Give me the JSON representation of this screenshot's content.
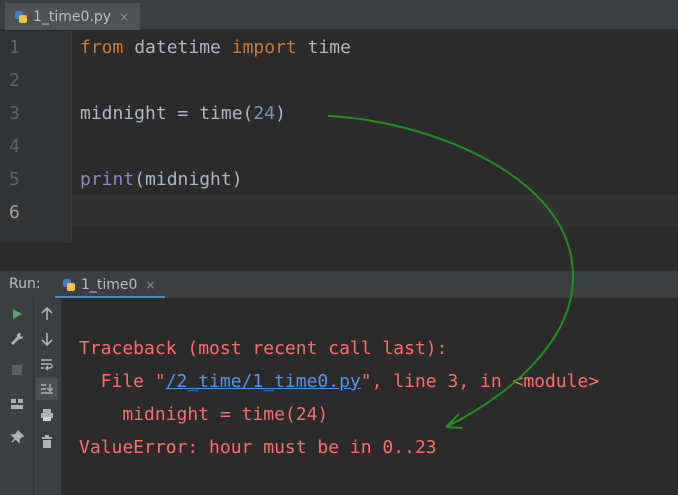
{
  "editor": {
    "tab": {
      "filename": "1_time0.py",
      "close": "×",
      "icon": "python-file-icon"
    },
    "lines": [
      {
        "no": "1",
        "tokens": [
          {
            "t": "from",
            "c": "kw"
          },
          {
            "t": " datetime ",
            "c": ""
          },
          {
            "t": "import",
            "c": "kw"
          },
          {
            "t": " time",
            "c": ""
          }
        ]
      },
      {
        "no": "2",
        "tokens": []
      },
      {
        "no": "3",
        "tokens": [
          {
            "t": "midnight = time(",
            "c": ""
          },
          {
            "t": "24",
            "c": "num"
          },
          {
            "t": ")",
            "c": ""
          }
        ]
      },
      {
        "no": "4",
        "tokens": []
      },
      {
        "no": "5",
        "tokens": [
          {
            "t": "print",
            "c": "builtin"
          },
          {
            "t": "(midnight)",
            "c": ""
          }
        ]
      },
      {
        "no": "6",
        "tokens": []
      }
    ]
  },
  "run": {
    "label": "Run:",
    "tab": {
      "name": "1_time0",
      "close": "×",
      "icon": "python-file-icon"
    },
    "toolbar_left": [
      "run-icon",
      "wrench-icon",
      "stop-icon",
      "layout-icon",
      "pin-icon"
    ],
    "toolbar_right": [
      "arrow-up-icon",
      "arrow-down-icon",
      "soft-wrap-icon",
      "scroll-to-end-icon",
      "print-icon",
      "trash-icon"
    ],
    "console": {
      "line1": "Traceback (most recent call last):",
      "line2_prefix": "  File \"",
      "line2_link": "/2_time/1_time0.py",
      "line2_suffix": "\", line 3, in <module>",
      "line3": "    midnight = time(24)",
      "line4": "ValueError: hour must be in 0..23"
    }
  },
  "colors": {
    "keyword": "#cc7832",
    "number": "#6897bb",
    "builtin": "#8888c6",
    "error": "#ff6b68",
    "link": "#5394ec",
    "annotation_arrow": "#1f8f1f"
  }
}
